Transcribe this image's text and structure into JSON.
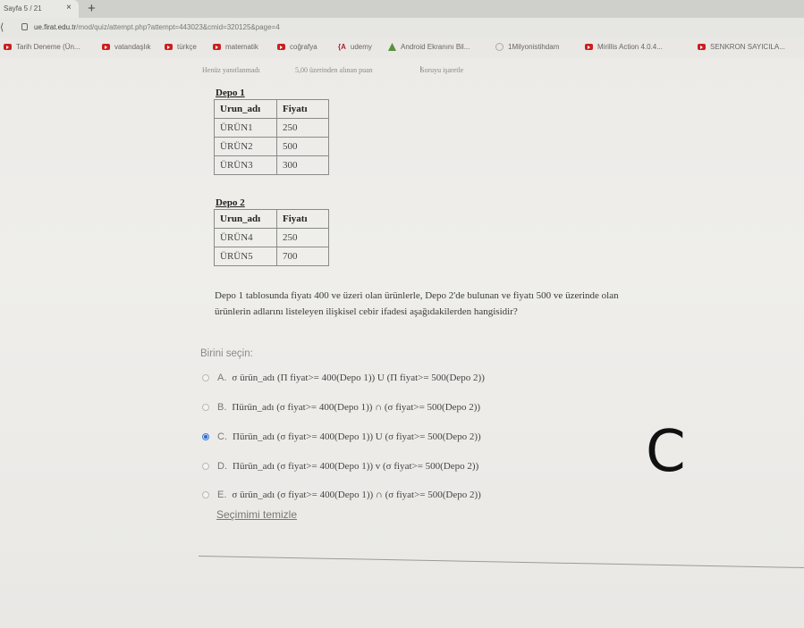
{
  "browser": {
    "tab_title": "Sayfa 5 / 21",
    "tab_close": "×",
    "new_tab": "+",
    "back": "⟨",
    "url_host": "ue.firat.edu.tr",
    "url_path": "/mod/quiz/attempt.php?attempt=443023&cmid=320125&page=4",
    "bookmarks": [
      {
        "label": "Tarih Deneme (Ün...",
        "icon": "youtube-icon"
      },
      {
        "label": "vatandaşlık",
        "icon": "youtube-icon"
      },
      {
        "label": "türkçe",
        "icon": "youtube-icon"
      },
      {
        "label": "matematik",
        "icon": "youtube-icon"
      },
      {
        "label": "coğrafya",
        "icon": "youtube-icon"
      },
      {
        "label": "udemy",
        "icon": "udemy-icon"
      },
      {
        "label": "Android Ekranını Bil...",
        "icon": "android-icon"
      },
      {
        "label": "1Milyonistihdam",
        "icon": "globe-icon"
      },
      {
        "label": "Mirillis Action 4.0.4...",
        "icon": "youtube-icon"
      },
      {
        "label": "SENKRON SAYICILA...",
        "icon": "youtube-icon"
      }
    ]
  },
  "question_info": {
    "status": "Henüz yanıtlanmadı",
    "points": "5,00 üzerinden alınan puan",
    "flag": "Soruyu işaretle"
  },
  "depo1": {
    "title": "Depo 1",
    "headers": [
      "Urun_adı",
      "Fiyatı"
    ],
    "rows": [
      [
        "ÜRÜN1",
        "250"
      ],
      [
        "ÜRÜN2",
        "500"
      ],
      [
        "ÜRÜN3",
        "300"
      ]
    ]
  },
  "depo2": {
    "title": "Depo 2",
    "headers": [
      "Urun_adı",
      "Fiyatı"
    ],
    "rows": [
      [
        "ÜRÜN4",
        "250"
      ],
      [
        "ÜRÜN5",
        "700"
      ]
    ]
  },
  "question": {
    "line1": "Depo 1 tablosunda fiyatı 400 ve üzeri olan ürünlerle, Depo 2'de bulunan ve fiyatı 500 ve üzerinde olan",
    "line2": "ürünlerin adlarını listeleyen ilişkisel cebir ifadesi aşağıdakilerden hangisidir?"
  },
  "prompt": "Birini seçin:",
  "options": [
    {
      "letter": "A.",
      "expr": "σ ürün_adı (Π fiyat>= 400(Depo 1)) U (Π fiyat>= 500(Depo 2))",
      "selected": false
    },
    {
      "letter": "B.",
      "expr": "Πürün_adı (σ fiyat>= 400(Depo 1)) ∩ (σ fiyat>= 500(Depo 2))",
      "selected": false
    },
    {
      "letter": "C.",
      "expr": "Πürün_adı (σ fiyat>= 400(Depo 1)) U (σ fiyat>= 500(Depo 2))",
      "selected": true
    },
    {
      "letter": "D.",
      "expr": "Πürün_adı (σ fiyat>= 400(Depo 1)) v (σ fiyat>= 500(Depo 2))",
      "selected": false
    },
    {
      "letter": "E.",
      "expr": "σ ürün_adı (σ fiyat>= 400(Depo 1)) ∩ (σ fiyat>= 500(Depo 2))",
      "selected": false
    }
  ],
  "clear_choice": "Seçimimi temizle",
  "handwritten_answer": "C"
}
